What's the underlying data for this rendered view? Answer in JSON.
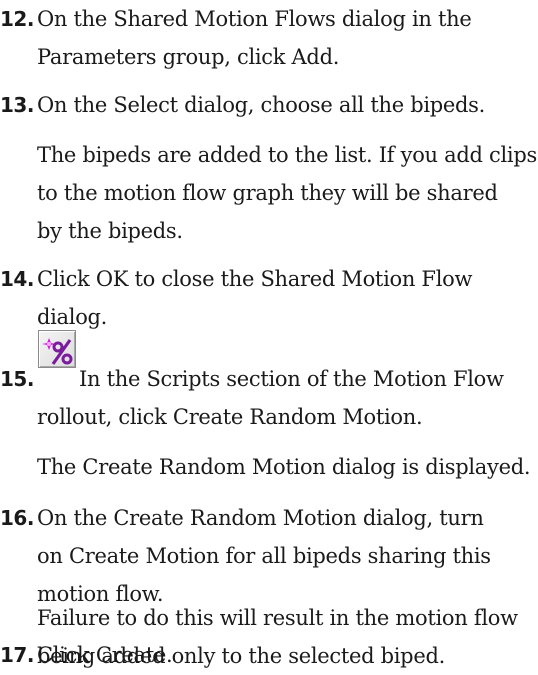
{
  "steps": [
    {
      "number": "12.",
      "lines": [
        "On the Shared Motion Flows dialog in the",
        "Parameters group, click Add."
      ]
    },
    {
      "number": "13.",
      "lines": [
        "On the Select dialog, choose all the bipeds."
      ]
    },
    {
      "note": [
        "The bipeds are added to the list. If you add clips",
        "to the motion flow graph they will be shared",
        "by the bipeds."
      ]
    },
    {
      "number": "14.",
      "lines": [
        "Click OK to close the Shared Motion Flow",
        "dialog."
      ]
    },
    {
      "number": "15.",
      "lines": [
        "In the Scripts section of the Motion Flow",
        "rollout, click Create Random Motion."
      ],
      "icon": "create-random-motion-icon"
    },
    {
      "note": [
        "The Create Random Motion dialog is displayed."
      ]
    },
    {
      "number": "16.",
      "lines": [
        "On the Create Random Motion dialog, turn",
        "on Create Motion for all bipeds sharing this",
        "motion flow."
      ]
    },
    {
      "note": [
        "Failure to do this will result in the motion flow",
        "being added only to the selected biped."
      ]
    },
    {
      "number": "17.",
      "lines": [
        "Click Create."
      ]
    }
  ],
  "colors": {
    "icon_accent": "#d61ee0",
    "icon_symbol": "#7a1c9c",
    "text": "#1a1a1a"
  }
}
